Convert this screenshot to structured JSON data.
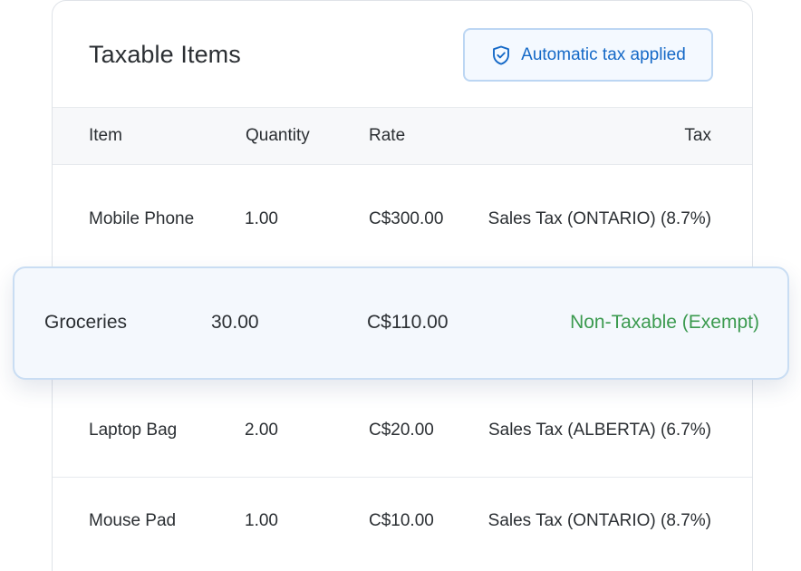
{
  "card": {
    "title": "Taxable Items",
    "badge": {
      "label": "Automatic tax applied",
      "icon": "shield-check-icon",
      "color": "#1569c7"
    }
  },
  "table": {
    "headers": {
      "item": "Item",
      "quantity": "Quantity",
      "rate": "Rate",
      "tax": "Tax"
    },
    "rows": [
      {
        "item": "Mobile Phone",
        "quantity": "1.00",
        "rate": "C$300.00",
        "tax": "Sales Tax (ONTARIO) (8.7%)"
      },
      {
        "item": "Laptop Bag",
        "quantity": "2.00",
        "rate": "C$20.00",
        "tax": "Sales Tax (ALBERTA) (6.7%)"
      },
      {
        "item": "Mouse Pad",
        "quantity": "1.00",
        "rate": "C$10.00",
        "tax": "Sales Tax (ONTARIO) (8.7%)"
      }
    ],
    "highlighted": {
      "item": "Groceries",
      "quantity": "30.00",
      "rate": "C$110.00",
      "tax": "Non-Taxable (Exempt)",
      "tax_color": "#3b9a4f"
    }
  }
}
